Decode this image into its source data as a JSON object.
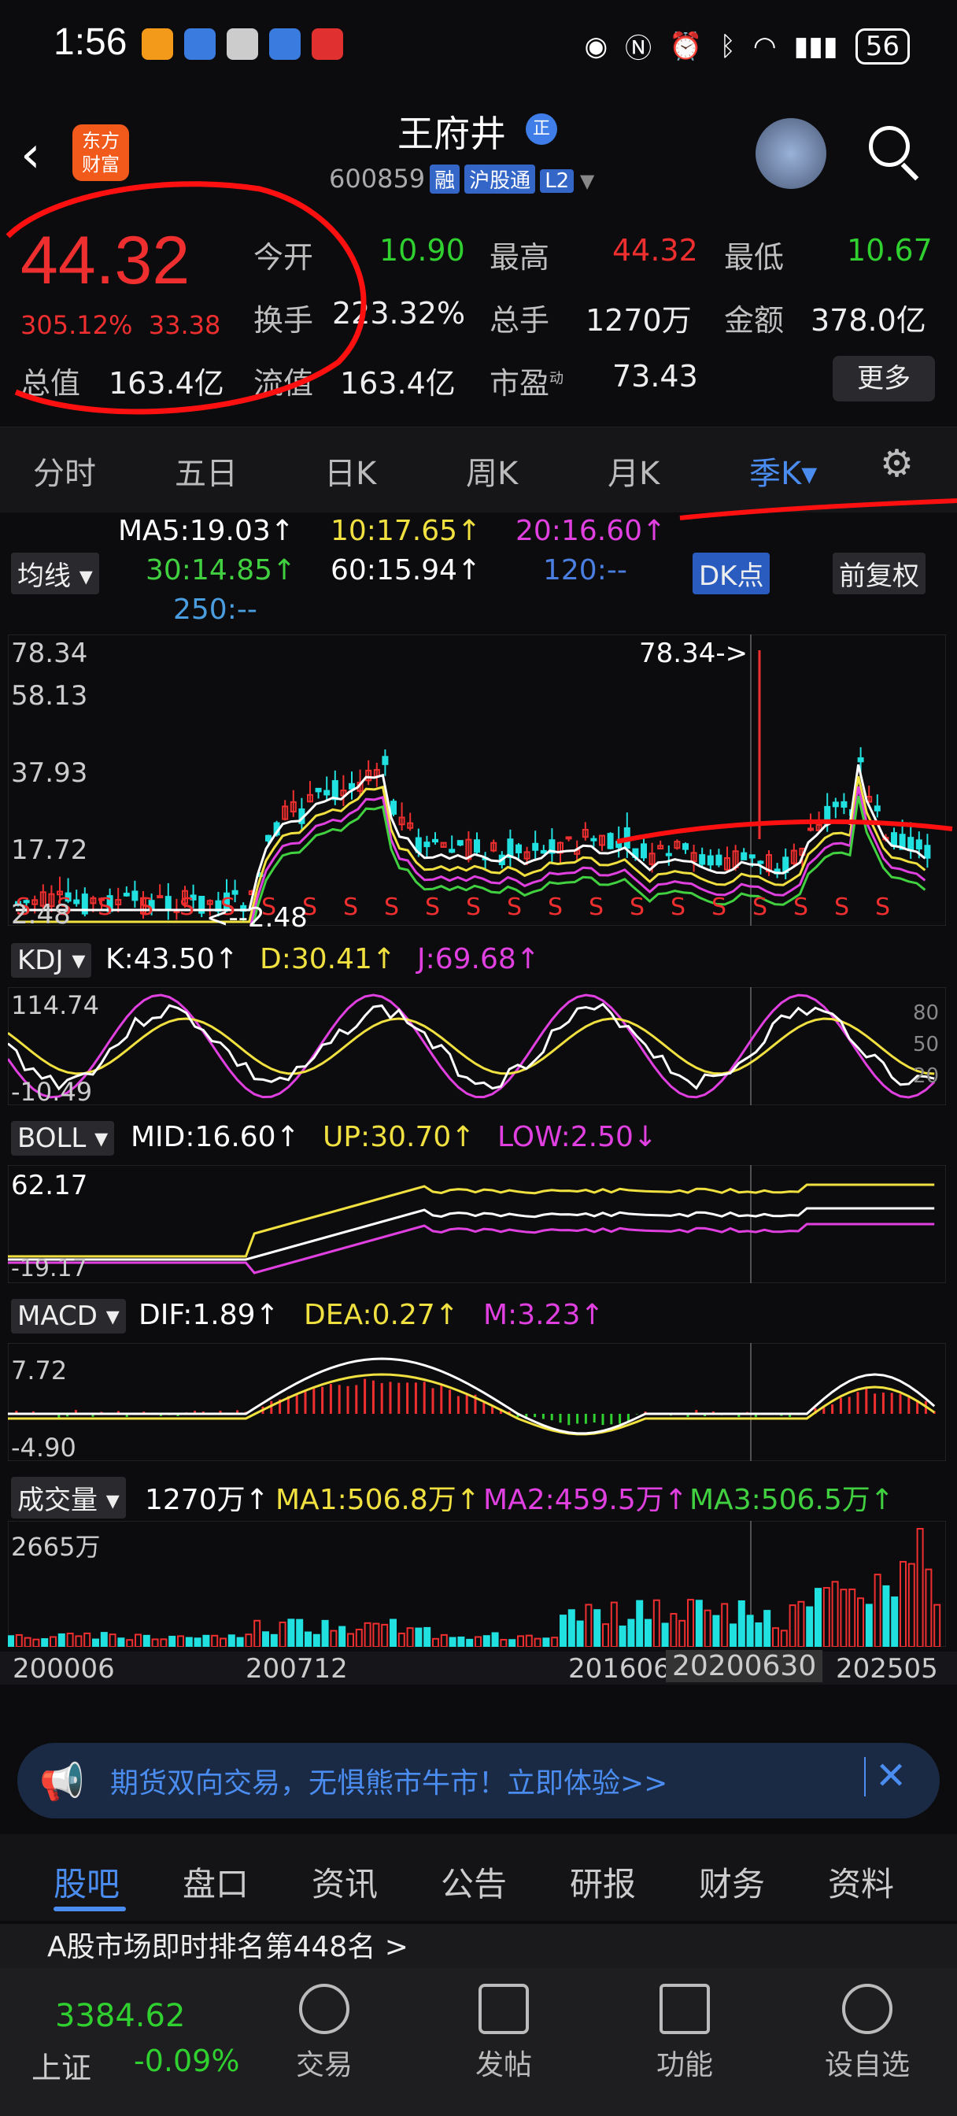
{
  "status": {
    "time": "1:56",
    "battery": "56"
  },
  "header": {
    "logo": "东方\n财富",
    "name": "王府井",
    "badge": "正",
    "code": "600859",
    "tags": [
      "融",
      "沪股通",
      "L2"
    ]
  },
  "quote": {
    "price": "44.32",
    "pct": "305.12%",
    "chg": "33.38",
    "open_l": "今开",
    "open": "10.90",
    "high_l": "最高",
    "high": "44.32",
    "low_l": "最低",
    "low": "10.67",
    "turn_l": "换手",
    "turn": "223.32%",
    "vol_l": "总手",
    "vol": "1270万",
    "amt_l": "金额",
    "amt": "378.0亿",
    "cap_l": "总值",
    "cap": "163.4亿",
    "fcap_l": "流值",
    "fcap": "163.4亿",
    "pe_l": "市盈",
    "pe_sup": "动",
    "pe": "73.43",
    "more": "更多"
  },
  "tabs": [
    "分时",
    "五日",
    "日K",
    "周K",
    "月K",
    "季K▾"
  ],
  "ma": {
    "ma5": "MA5:19.03↑",
    "ma10": "10:17.65↑",
    "ma20": "20:16.60↑",
    "ma30": "30:14.85↑",
    "ma60": "60:15.94↑",
    "ma120": "120:--",
    "ma250": "250:--",
    "btn": "均线",
    "dk": "DK点",
    "fq": "前复权"
  },
  "kaxis": {
    "a1": "78.34",
    "a2": "58.13",
    "a3": "37.93",
    "a4": "17.72",
    "a5": "2.48",
    "max": "78.34->",
    "min": "<--2.48"
  },
  "kdj": {
    "btn": "KDJ",
    "k": "K:43.50↑",
    "d": "D:30.41↑",
    "j": "J:69.68↑",
    "top": "114.74",
    "bot": "-10.49",
    "r80": "80",
    "r50": "50",
    "r20": "20"
  },
  "boll": {
    "btn": "BOLL",
    "mid": "MID:16.60↑",
    "up": "UP:30.70↑",
    "low": "LOW:2.50↓",
    "top": "62.17",
    "bot": "-19.17"
  },
  "macd": {
    "btn": "MACD",
    "dif": "DIF:1.89↑",
    "dea": "DEA:0.27↑",
    "m": "M:3.23↑",
    "top": "7.72",
    "bot": "-4.90"
  },
  "volume": {
    "btn": "成交量",
    "v": "1270万↑",
    "ma1": "MA1:506.8万↑",
    "ma2": "MA2:459.5万↑",
    "ma3": "MA3:506.5万↑",
    "top": "2665万"
  },
  "xaxis": {
    "d1": "200006",
    "d2": "200712",
    "d3": "201606",
    "d4": "20200630",
    "d5": "202505"
  },
  "banner": {
    "text": "期货双向交易，无惧熊市牛市！立即体验>>"
  },
  "bottomtabs": [
    "股吧",
    "盘口",
    "资讯",
    "公告",
    "研报",
    "财务",
    "资料"
  ],
  "news": "A股市场即时排名第448名 >",
  "nav": {
    "index": "3384.62",
    "index_name": "上证",
    "index_chg": "-0.09%",
    "items": [
      "交易",
      "发帖",
      "功能",
      "设自选"
    ]
  },
  "colors": {
    "up": "#ef2f2f",
    "down": "#2fd02f",
    "accent": "#4a8cf0",
    "ma5": "#ffffff",
    "ma10": "#f0e040",
    "ma20": "#e040e0",
    "ma30": "#40d040"
  }
}
